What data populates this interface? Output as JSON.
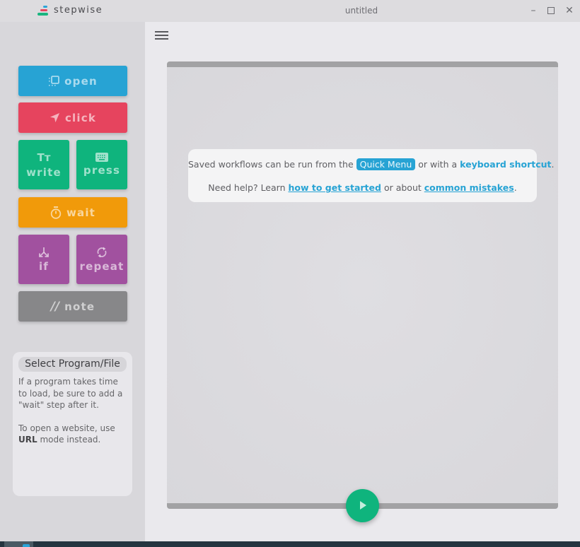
{
  "titlebar": {
    "app_name": "stepwise",
    "window_title": "untitled",
    "controls": {
      "minimize": "–",
      "maximize": "□",
      "close": "✕"
    },
    "logo_colors": [
      "#2ba4d8",
      "#e84560",
      "#1ab57f"
    ]
  },
  "sidebar": {
    "steps": [
      {
        "id": "open",
        "label": "open",
        "icon": "open-window-icon",
        "color": "#27a3d4"
      },
      {
        "id": "click",
        "label": "click",
        "icon": "cursor-arrow-icon",
        "color": "#e6445e"
      },
      {
        "id": "write",
        "label": "write",
        "icon": "text-size-icon",
        "icon_text": "Tт",
        "color": "#0fb47d"
      },
      {
        "id": "press",
        "label": "press",
        "icon": "keyboard-icon",
        "color": "#0fb47d"
      },
      {
        "id": "wait",
        "label": "wait",
        "icon": "stopwatch-icon",
        "color": "#f19a0a"
      },
      {
        "id": "if",
        "label": "if",
        "icon": "branch-icon",
        "color": "#a1519f"
      },
      {
        "id": "repeat",
        "label": "repeat",
        "icon": "repeat-icon",
        "color": "#a1519f"
      },
      {
        "id": "note",
        "label": "note",
        "icon": "comment-slashes-icon",
        "icon_text": "//",
        "color": "#878789"
      }
    ],
    "info": {
      "title": "Select Program/File",
      "para1": "If a program takes time to load, be sure to add a \"wait\" step after it.",
      "para2_prefix": "To open a website, use ",
      "para2_bold": "URL",
      "para2_suffix": " mode instead."
    }
  },
  "main": {
    "menu_icon": "hamburger-menu-icon",
    "tip": {
      "line1_prefix": "Saved workflows can be run from the ",
      "quick_menu": "Quick Menu",
      "line1_mid": " or with a ",
      "keyboard_shortcut": "keyboard shortcut",
      "line1_end": ".",
      "line2_prefix": "Need help? Learn ",
      "get_started_link": "how to get started",
      "line2_mid": " or about ",
      "mistakes_link": "common mistakes",
      "line2_end": "."
    },
    "run_button": {
      "icon": "play-icon",
      "color": "#0fb47d"
    }
  }
}
